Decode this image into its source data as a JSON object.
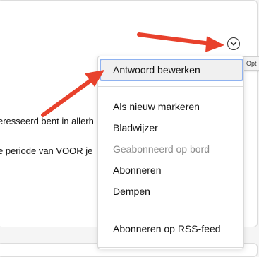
{
  "post": {
    "line1": "eresseerd bent in allerh",
    "line2": "e periode van VOOR je"
  },
  "options_button": {
    "icon": "chevron-down-circle-icon"
  },
  "tooltip": {
    "text": "Opt"
  },
  "menu": {
    "items": [
      {
        "label": "Antwoord bewerken",
        "state": "focused"
      },
      {
        "label": "Als nieuw markeren",
        "state": "normal"
      },
      {
        "label": "Bladwijzer",
        "state": "normal"
      },
      {
        "label": "Geabonneerd op bord",
        "state": "disabled"
      },
      {
        "label": "Abonneren",
        "state": "normal"
      },
      {
        "label": "Dempen",
        "state": "normal"
      },
      {
        "label": "Abonneren op RSS-feed",
        "state": "normal"
      }
    ]
  },
  "colors": {
    "annotation_arrow": "#e8412c",
    "focus_ring": "#8fb2f0",
    "disabled_text": "#8c8c8c"
  }
}
